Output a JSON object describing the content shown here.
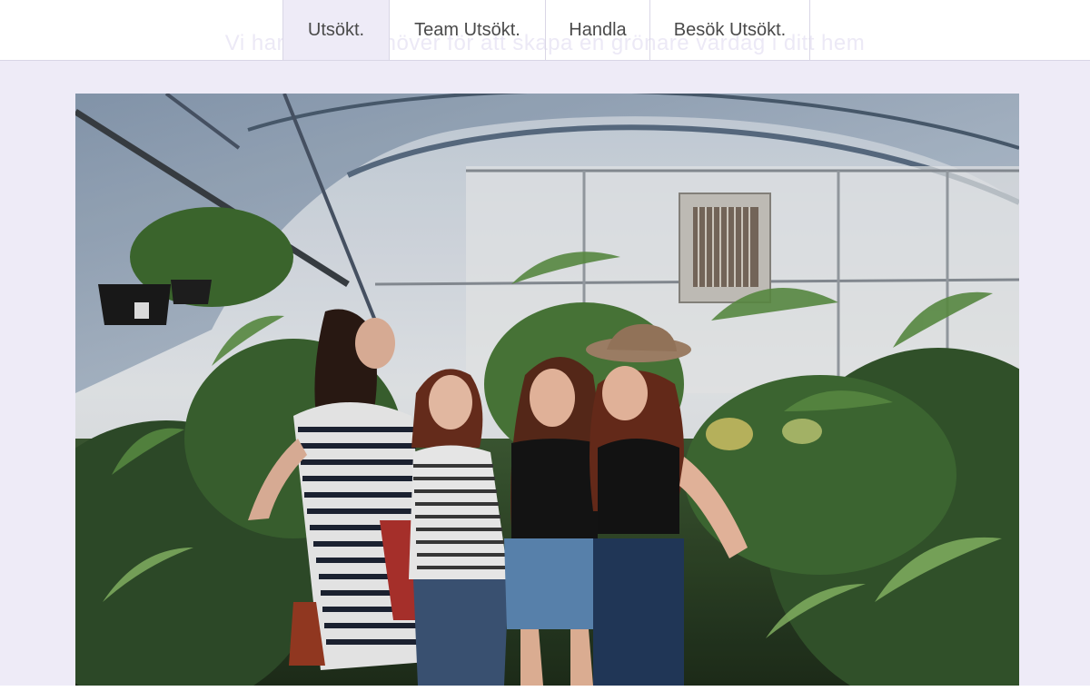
{
  "header": {
    "ghost_text": "Vi har allt du behöver för att skapa en grönare vardag i ditt hem",
    "nav": [
      {
        "label": "Utsökt.",
        "active": true
      },
      {
        "label": "Team Utsökt.",
        "active": false
      },
      {
        "label": "Handla",
        "active": false
      },
      {
        "label": "Besök Utsökt.",
        "active": false
      }
    ]
  },
  "hero": {
    "image": "photo-four-friends-in-greenhouse"
  },
  "colors": {
    "page_background": "#eeebf7",
    "header_background": "#ffffff",
    "nav_active_background": "#eeebf7",
    "nav_text": "#4a4a4a",
    "divider": "#d9d6e6"
  }
}
